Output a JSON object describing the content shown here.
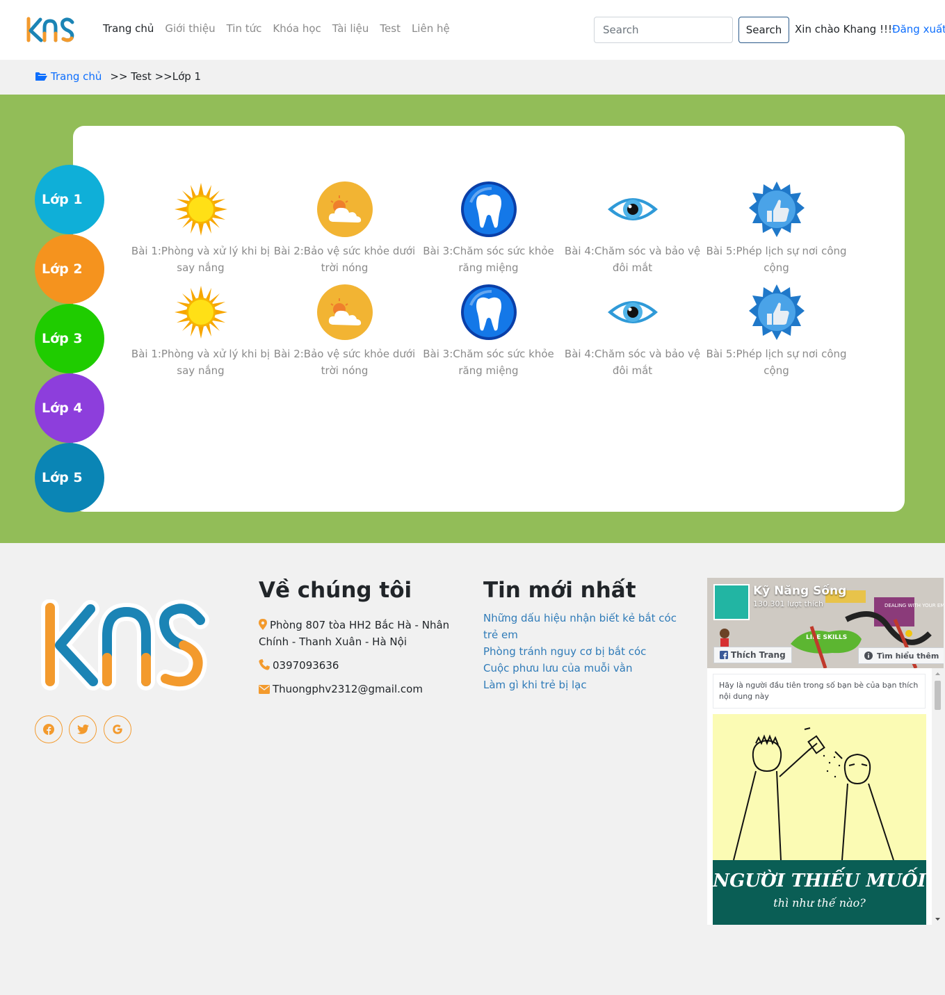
{
  "nav": {
    "logo_text": "KNS",
    "links": [
      "Trang chủ",
      "Giới thiệu",
      "Tin tức",
      "Khóa học",
      "Tài liệu",
      "Test",
      "Liên hệ"
    ],
    "search_placeholder": "Search",
    "search_button": "Search",
    "greeting": "Xin chào Khang !!!",
    "logout": "Đăng xuất"
  },
  "breadcrumb": {
    "home": "Trang chủ",
    "rest": ">> Test >>Lớp 1"
  },
  "grades": [
    {
      "label": "Lớp 1",
      "color": "#0fafd8"
    },
    {
      "label": "Lớp 2",
      "color": "#f5931e"
    },
    {
      "label": "Lớp 3",
      "color": "#1fcc00"
    },
    {
      "label": "Lớp 4",
      "color": "#8d3edc"
    },
    {
      "label": "Lớp 5",
      "color": "#0a85b5"
    }
  ],
  "lessons": [
    {
      "title": "Bài 1:Phòng và xử lý khi bị say nắng",
      "icon": "sun-icon"
    },
    {
      "title": "Bài 2:Bảo vệ sức khỏe dưới trời nóng",
      "icon": "sun-cloud-icon"
    },
    {
      "title": "Bài 3:Chăm sóc sức khỏe răng miệng",
      "icon": "tooth-icon"
    },
    {
      "title": "Bài 4:Chăm sóc và bảo vệ đôi mắt",
      "icon": "eye-icon"
    },
    {
      "title": "Bài 5:Phép lịch sự nơi công cộng",
      "icon": "thumbs-up-badge-icon"
    }
  ],
  "footer": {
    "logo_text": "KNS",
    "about_heading": "Về chúng tôi",
    "address": "Phòng 807 tòa HH2 Bắc Hà - Nhân Chính - Thanh Xuân - Hà Nội",
    "phone": "0397093636",
    "email": "Thuongphv2312@gmail.com",
    "news_heading": "Tin mới nhất",
    "news": [
      "Những dấu hiệu nhận biết kẻ bắt cóc trẻ em",
      "Phòng tránh nguy cơ bị bắt cóc",
      "Cuộc phưu lưu của muỗi vằn",
      "Làm gì khi trẻ bị lạc"
    ],
    "social": [
      "facebook-icon",
      "twitter-icon",
      "google-icon"
    ]
  },
  "fb_widget": {
    "page_name": "Kỹ Năng Sống",
    "likes": "130.301 lượt thích",
    "like_button": "Thích Trang",
    "learn_more": "Tìm hiểu thêm",
    "friend_note": "Hãy là người đầu tiên trong số bạn bè của bạn thích nội dung này",
    "cover_tags": [
      "LIFE SKILLS",
      "DEALING WITH YOUR EMOTIONS"
    ],
    "post_title": "NGƯỜI THIẾU MUỐI",
    "post_subtitle": "thì như thế nào?"
  },
  "colors": {
    "green_band": "#92bd58",
    "link_blue": "#0d6efd",
    "orange": "#f39a2d"
  }
}
